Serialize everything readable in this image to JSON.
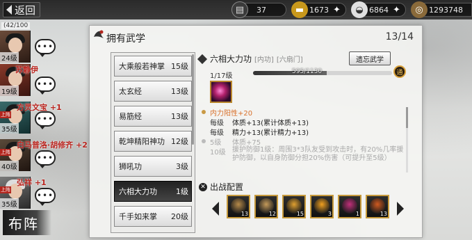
{
  "topbar": {
    "back_label": "返回",
    "resources": [
      {
        "icon": "ticket-icon",
        "value": "37"
      },
      {
        "icon": "gold-ingot-icon",
        "value": "1673"
      },
      {
        "icon": "silver-ingot-icon",
        "value": "6864"
      },
      {
        "icon": "copper-coin-icon",
        "value": "1293748"
      }
    ]
  },
  "roster": {
    "count": "(42/100",
    "heroes": [
      {
        "name": "",
        "level": "24级",
        "tag": ""
      },
      {
        "name": "苏静伊",
        "level": "19级",
        "tag": ""
      },
      {
        "name": "方灵文宝 +1",
        "level": "35级",
        "tag": "上阵"
      },
      {
        "name": "白马普洛·胡修齐 +2",
        "level": "40级",
        "tag": "上阵"
      },
      {
        "name": "弘祥 +1",
        "level": "35级",
        "tag": "上阵"
      }
    ],
    "formation_label": "布阵"
  },
  "panel": {
    "title": "拥有武学",
    "count": "13/14",
    "skills": [
      {
        "name": "大乘般若神掌",
        "level": "15级"
      },
      {
        "name": "太玄经",
        "level": "13级"
      },
      {
        "name": "易筋经",
        "level": "13级"
      },
      {
        "name": "乾坤精阳神功",
        "level": "12级"
      },
      {
        "name": "狮吼功",
        "level": "3级"
      },
      {
        "name": "六相大力功",
        "level": "1级"
      },
      {
        "name": "千手如来掌",
        "level": "20级"
      }
    ],
    "selected_index": 5
  },
  "detail": {
    "name": "六相大力功",
    "type": "[内功]",
    "school": "[六扇门]",
    "forget_label": "遗忘武学",
    "level": "1/17级",
    "exp_text": "595/1130",
    "exp_progress": 0.53,
    "upgrade_label": "通",
    "stats": [
      {
        "label": "",
        "value": "内力阳性+20",
        "style": "main"
      },
      {
        "label": "每级",
        "value": "体质+13(累计体质+13)",
        "style": "normal"
      },
      {
        "label": "每级",
        "value": "精力+13(累计精力+13)",
        "style": "normal"
      },
      {
        "label": "5级",
        "value": "体质+75",
        "style": "dim"
      },
      {
        "label": "10级",
        "value": "援护防御1级：周围3*3队友受到攻击时，有20%几率援护防御，以自身防御分担20%伤害（可提升至5级）",
        "style": "dim"
      }
    ],
    "battle_title": "出战配置",
    "battle_slots": [
      {
        "count": "13",
        "color": "#b68a4a"
      },
      {
        "count": "12",
        "color": "#c49a5a"
      },
      {
        "count": "15",
        "color": "#e0a030"
      },
      {
        "count": "3",
        "color": "#f0a020"
      },
      {
        "count": "1",
        "color": "#c0307a"
      },
      {
        "count": "13",
        "color": "#d05a20"
      }
    ]
  }
}
